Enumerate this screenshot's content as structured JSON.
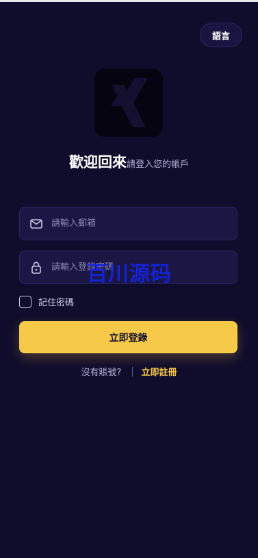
{
  "header": {
    "language_label": "語言"
  },
  "welcome": {
    "title": "歡迎回來",
    "subtitle": "請登入您的帳戶"
  },
  "form": {
    "email_placeholder": "請輸入郵箱",
    "email_value": "",
    "password_placeholder": "請輸入登錄密碼",
    "password_value": "",
    "remember_label": "記住密碼",
    "remember_checked": false,
    "login_label": "立即登錄"
  },
  "footer": {
    "no_account": "沒有賬號?",
    "register_label": "立即註冊"
  },
  "watermark": {
    "text": "百川源码"
  },
  "icons": {
    "logo": "x-logo-icon",
    "email": "mail-icon",
    "password": "lock-icon",
    "checkbox": "checkbox-icon"
  },
  "colors": {
    "background": "#100c2c",
    "field_background": "#1b1745",
    "accent": "#f7c948",
    "watermark": "#1524e8"
  }
}
